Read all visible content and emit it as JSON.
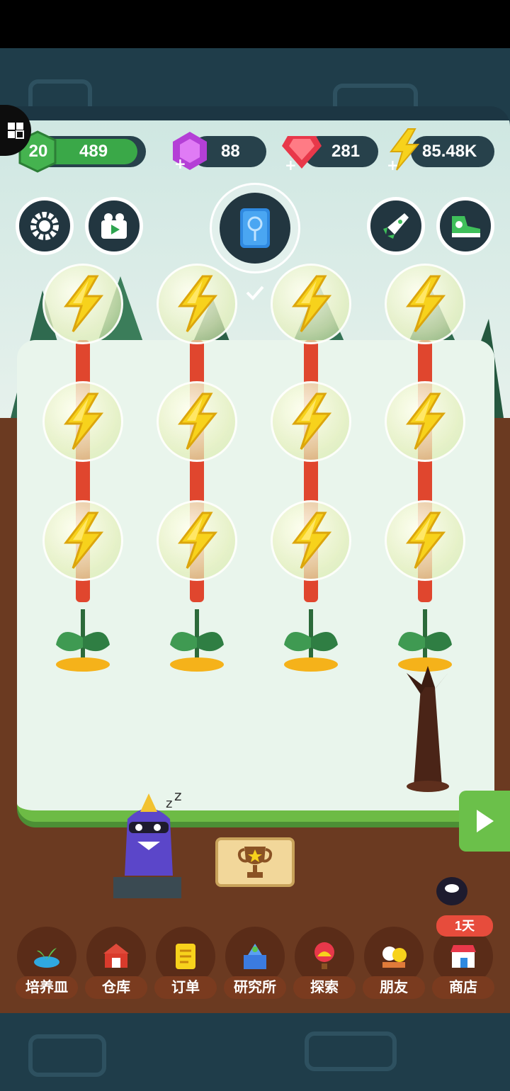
{
  "resources": {
    "level": "20",
    "xp": "489",
    "gems": "88",
    "rubies": "281",
    "energy": "85.48K"
  },
  "top_buttons": {
    "settings_icon": "gear-icon",
    "video_icon": "video-icon",
    "book_icon": "book-icon",
    "rocket_icon": "rocket-icon",
    "shoe_icon": "sneaker-icon"
  },
  "grid": {
    "rows": 3,
    "columns": 4,
    "item": "energy-bolt-bubble"
  },
  "trophy_icon": "trophy-icon",
  "nav": {
    "items": [
      {
        "label": "培养皿",
        "icon": "petri-dish-icon"
      },
      {
        "label": "仓库",
        "icon": "barn-icon"
      },
      {
        "label": "订单",
        "icon": "scroll-icon"
      },
      {
        "label": "研究所",
        "icon": "lab-icon"
      },
      {
        "label": "探索",
        "icon": "balloon-icon"
      },
      {
        "label": "朋友",
        "icon": "friends-icon"
      },
      {
        "label": "商店",
        "icon": "shop-icon"
      }
    ],
    "shop_badge": "1天"
  },
  "colors": {
    "accent_green": "#3aa848",
    "energy_yellow": "#f7d21c",
    "gem_purple": "#b43fd6",
    "ruby_red": "#e8384a"
  }
}
